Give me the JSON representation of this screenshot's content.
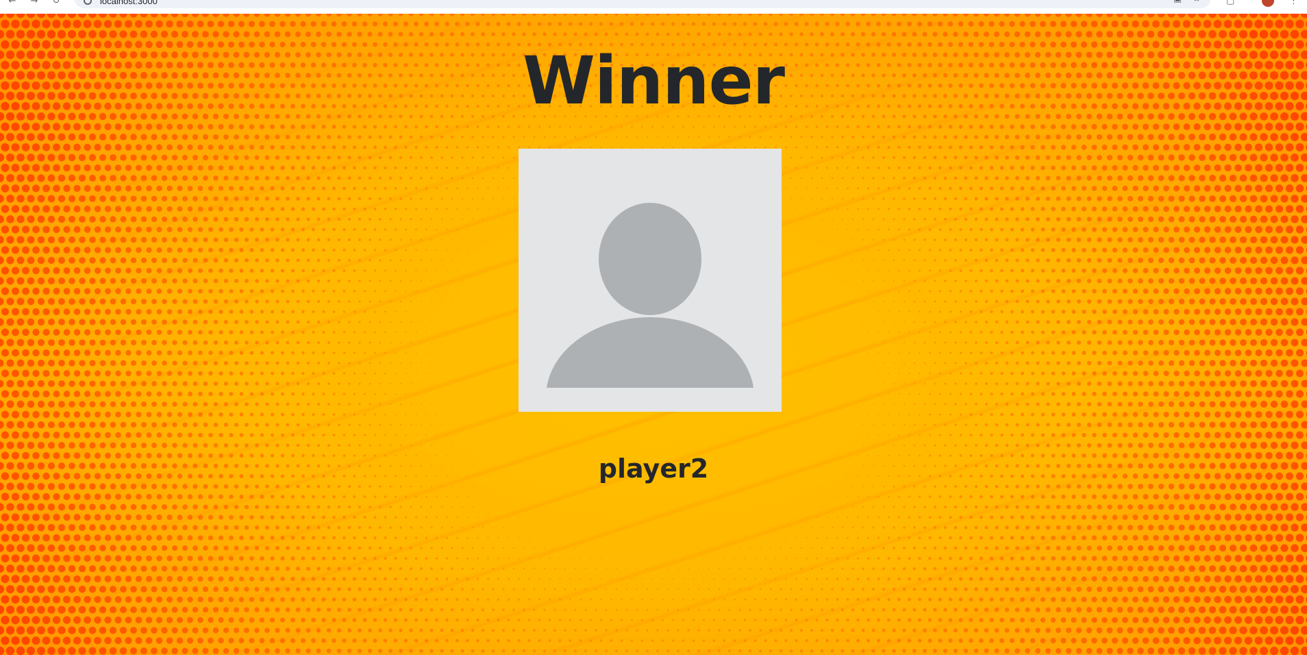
{
  "browser": {
    "address": "localhost:3000",
    "back_icon": "back-arrow-icon",
    "forward_icon": "forward-arrow-icon",
    "reload_icon": "reload-icon"
  },
  "winner_screen": {
    "heading": "Winner",
    "player_name": "player2",
    "avatar_icon": "default-user-silhouette-icon"
  },
  "colors": {
    "background_primary": "#ffb300",
    "background_secondary": "#ff8a00",
    "halftone_dot": "#ff5a00",
    "text": "#23272b",
    "avatar_bg": "#e4e5e7",
    "avatar_silhouette": "#adb1b4"
  }
}
